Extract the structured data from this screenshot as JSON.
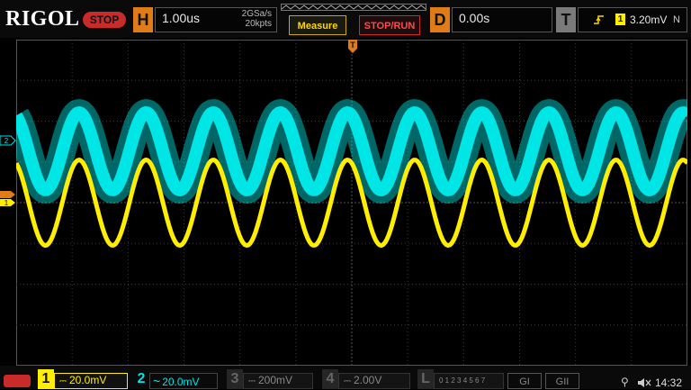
{
  "header": {
    "logo": "RIGOL",
    "run_state": "STOP",
    "horizontal": {
      "tag": "H",
      "timebase": "1.00us",
      "sample_rate": "2GSa/s",
      "memory_depth": "20kpts"
    },
    "measure_label": "Measure",
    "stoprun_label": "STOP/RUN",
    "delay": {
      "tag": "D",
      "value": "0.00s"
    },
    "trigger": {
      "tag": "T",
      "source": "1",
      "level": "3.20mV",
      "mode": "N"
    }
  },
  "markers": {
    "trigger_position": "T",
    "ch1": "1",
    "ch2": "2"
  },
  "channels": [
    {
      "num": "1",
      "coupling": "DC",
      "scale": "20.0mV",
      "color": "#ffee00",
      "active": true
    },
    {
      "num": "2",
      "coupling": "AC",
      "scale": "20.0mV",
      "color": "#00e5e5",
      "active": true
    },
    {
      "num": "3",
      "coupling": "DC",
      "scale": "200mV",
      "color": "#888888",
      "active": false
    },
    {
      "num": "4",
      "coupling": "DC",
      "scale": "2.00V",
      "color": "#888888",
      "active": false
    }
  ],
  "logic": {
    "tag": "L",
    "digits": "0 1 2 3  4 5 6 7"
  },
  "gi_labels": [
    "GI",
    "GII"
  ],
  "status": {
    "time": "14:32"
  },
  "colors": {
    "ch1": "#ffee00",
    "ch2": "#00e5e5",
    "accent": "#e07b1a",
    "stop": "#c92a2a"
  },
  "waveform": {
    "cycles": 10,
    "ch1_amplitude_div": 1.05,
    "ch2_amplitude_div": 0.95
  }
}
